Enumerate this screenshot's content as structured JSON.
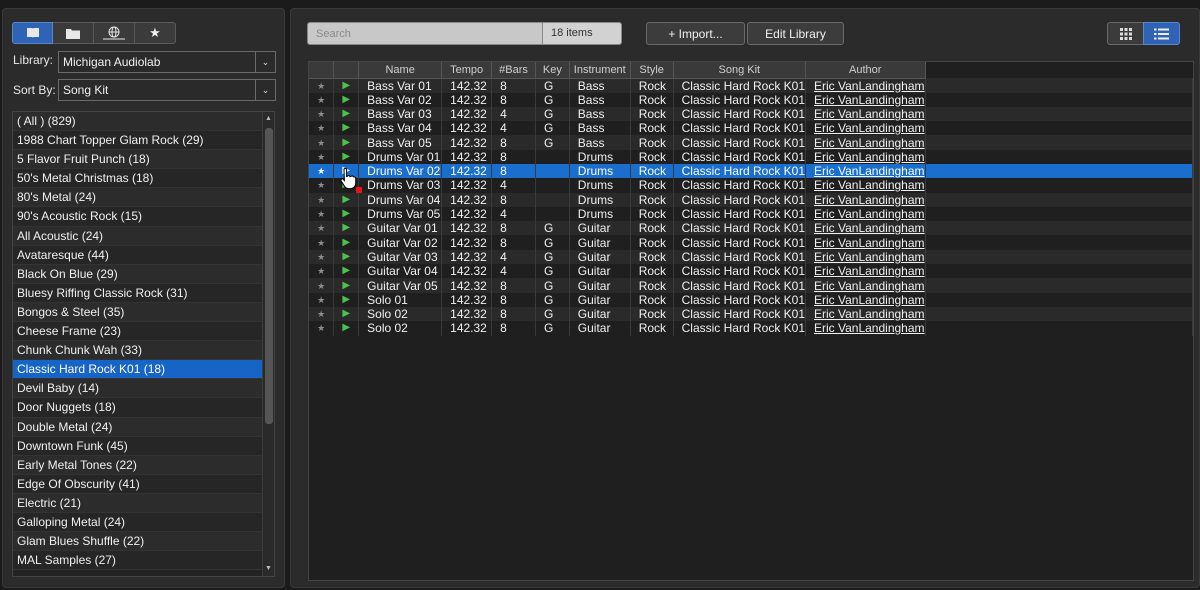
{
  "sidebar": {
    "tabs": [
      {
        "icon": "book-icon"
      },
      {
        "icon": "folder-icon"
      },
      {
        "icon": "globe-icon"
      },
      {
        "icon": "star-icon"
      }
    ],
    "library_label": "Library:",
    "library_value": "Michigan Audiolab",
    "sortby_label": "Sort By:",
    "sortby_value": "Song Kit",
    "items": [
      "( All ) (829)",
      "1988 Chart Topper Glam Rock (29)",
      "5 Flavor Fruit Punch (18)",
      "50's Metal Christmas (18)",
      "80's Metal (24)",
      "90's Acoustic Rock (15)",
      "All Acoustic (24)",
      "Avataresque (44)",
      "Black On Blue (29)",
      "Bluesy Riffing Classic Rock (31)",
      "Bongos & Steel (35)",
      "Cheese Frame (23)",
      "Chunk Chunk Wah (33)",
      "Classic Hard Rock K01 (18)",
      "Devil Baby (14)",
      "Door Nuggets (18)",
      "Double Metal (24)",
      "Downtown Funk (45)",
      "Early Metal Tones (22)",
      "Edge Of Obscurity (41)",
      "Electric (21)",
      "Galloping Metal (24)",
      "Glam Blues Shuffle (22)",
      "MAL Samples (27)"
    ],
    "selected_index": 13
  },
  "toolbar": {
    "search_placeholder": "Search",
    "items_count": "18 items",
    "import_label": "+ Import...",
    "edit_library_label": "Edit Library"
  },
  "table": {
    "columns": [
      "",
      "",
      "Name",
      "Tempo",
      "#Bars",
      "Key",
      "Instrument",
      "Style",
      "Song Kit",
      "Author"
    ],
    "rows": [
      {
        "name": "Bass Var 01",
        "tempo": "142.32",
        "bars": "8",
        "key": "G",
        "instrument": "Bass",
        "style": "Rock",
        "kit": "Classic Hard Rock K01",
        "author": "Eric VanLandingham"
      },
      {
        "name": "Bass Var 02",
        "tempo": "142.32",
        "bars": "8",
        "key": "G",
        "instrument": "Bass",
        "style": "Rock",
        "kit": "Classic Hard Rock K01",
        "author": "Eric VanLandingham"
      },
      {
        "name": "Bass Var 03",
        "tempo": "142.32",
        "bars": "4",
        "key": "G",
        "instrument": "Bass",
        "style": "Rock",
        "kit": "Classic Hard Rock K01",
        "author": "Eric VanLandingham"
      },
      {
        "name": "Bass Var 04",
        "tempo": "142.32",
        "bars": "4",
        "key": "G",
        "instrument": "Bass",
        "style": "Rock",
        "kit": "Classic Hard Rock K01",
        "author": "Eric VanLandingham"
      },
      {
        "name": "Bass Var 05",
        "tempo": "142.32",
        "bars": "8",
        "key": "G",
        "instrument": "Bass",
        "style": "Rock",
        "kit": "Classic Hard Rock K01",
        "author": "Eric VanLandingham"
      },
      {
        "name": "Drums Var 01",
        "tempo": "142.32",
        "bars": "8",
        "key": "",
        "instrument": "Drums",
        "style": "Rock",
        "kit": "Classic Hard Rock K01",
        "author": "Eric VanLandingham"
      },
      {
        "name": "Drums Var 02",
        "tempo": "142.32",
        "bars": "8",
        "key": "",
        "instrument": "Drums",
        "style": "Rock",
        "kit": "Classic Hard Rock K01",
        "author": "Eric VanLandingham"
      },
      {
        "name": "Drums Var 03",
        "tempo": "142.32",
        "bars": "4",
        "key": "",
        "instrument": "Drums",
        "style": "Rock",
        "kit": "Classic Hard Rock K01",
        "author": "Eric VanLandingham"
      },
      {
        "name": "Drums Var 04",
        "tempo": "142.32",
        "bars": "8",
        "key": "",
        "instrument": "Drums",
        "style": "Rock",
        "kit": "Classic Hard Rock K01",
        "author": "Eric VanLandingham"
      },
      {
        "name": "Drums Var 05",
        "tempo": "142.32",
        "bars": "4",
        "key": "",
        "instrument": "Drums",
        "style": "Rock",
        "kit": "Classic Hard Rock K01",
        "author": "Eric VanLandingham"
      },
      {
        "name": "Guitar Var 01",
        "tempo": "142.32",
        "bars": "8",
        "key": "G",
        "instrument": "Guitar",
        "style": "Rock",
        "kit": "Classic Hard Rock K01",
        "author": "Eric VanLandingham"
      },
      {
        "name": "Guitar Var 02",
        "tempo": "142.32",
        "bars": "8",
        "key": "G",
        "instrument": "Guitar",
        "style": "Rock",
        "kit": "Classic Hard Rock K01",
        "author": "Eric VanLandingham"
      },
      {
        "name": "Guitar Var 03",
        "tempo": "142.32",
        "bars": "4",
        "key": "G",
        "instrument": "Guitar",
        "style": "Rock",
        "kit": "Classic Hard Rock K01",
        "author": "Eric VanLandingham"
      },
      {
        "name": "Guitar Var 04",
        "tempo": "142.32",
        "bars": "4",
        "key": "G",
        "instrument": "Guitar",
        "style": "Rock",
        "kit": "Classic Hard Rock K01",
        "author": "Eric VanLandingham"
      },
      {
        "name": "Guitar Var 05",
        "tempo": "142.32",
        "bars": "8",
        "key": "G",
        "instrument": "Guitar",
        "style": "Rock",
        "kit": "Classic Hard Rock K01",
        "author": "Eric VanLandingham"
      },
      {
        "name": "Solo 01",
        "tempo": "142.32",
        "bars": "8",
        "key": "G",
        "instrument": "Guitar",
        "style": "Rock",
        "kit": "Classic Hard Rock K01",
        "author": "Eric VanLandingham"
      },
      {
        "name": "Solo 02",
        "tempo": "142.32",
        "bars": "8",
        "key": "G",
        "instrument": "Guitar",
        "style": "Rock",
        "kit": "Classic Hard Rock K01",
        "author": "Eric VanLandingham"
      },
      {
        "name": "Solo 02",
        "tempo": "142.32",
        "bars": "8",
        "key": "G",
        "instrument": "Guitar",
        "style": "Rock",
        "kit": "Classic Hard Rock K01",
        "author": "Eric VanLandingham"
      }
    ],
    "selected_index": 6
  },
  "colors": {
    "accent": "#1764c7",
    "play": "#4cc24c",
    "record": "#e11111"
  }
}
